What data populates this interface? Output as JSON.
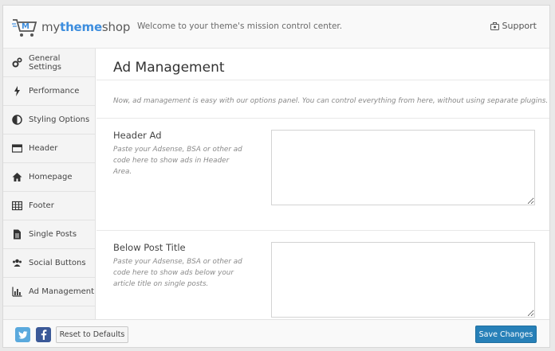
{
  "header": {
    "logo": {
      "my": "my",
      "theme": "theme",
      "shop": "shop"
    },
    "tagline": "Welcome to your theme's mission control center.",
    "support_label": "Support"
  },
  "sidebar": {
    "items": [
      {
        "label": "General Settings",
        "icon": "gears-icon"
      },
      {
        "label": "Performance",
        "icon": "bolt-icon"
      },
      {
        "label": "Styling Options",
        "icon": "contrast-icon"
      },
      {
        "label": "Header",
        "icon": "header-layout-icon"
      },
      {
        "label": "Homepage",
        "icon": "home-icon"
      },
      {
        "label": "Footer",
        "icon": "table-grid-icon"
      },
      {
        "label": "Single Posts",
        "icon": "document-icon"
      },
      {
        "label": "Social Buttons",
        "icon": "users-icon"
      },
      {
        "label": "Ad Management",
        "icon": "bar-chart-icon"
      }
    ]
  },
  "main": {
    "title": "Ad Management",
    "intro": "Now, ad management is easy with our options panel. You can control everything from here, without using separate plugins.",
    "fields": [
      {
        "label": "Header Ad",
        "description": "Paste your Adsense, BSA or other ad code here to show ads in Header Area.",
        "value": ""
      },
      {
        "label": "Below Post Title",
        "description": "Paste your Adsense, BSA or other ad code here to show ads below your article title on single posts.",
        "value": ""
      }
    ]
  },
  "footer": {
    "reset_label": "Reset to Defaults",
    "save_label": "Save Changes"
  },
  "colors": {
    "brand_blue": "#3e8ede",
    "save_button": "#2780b8",
    "twitter": "#5aa9dd",
    "facebook": "#3b5998"
  }
}
